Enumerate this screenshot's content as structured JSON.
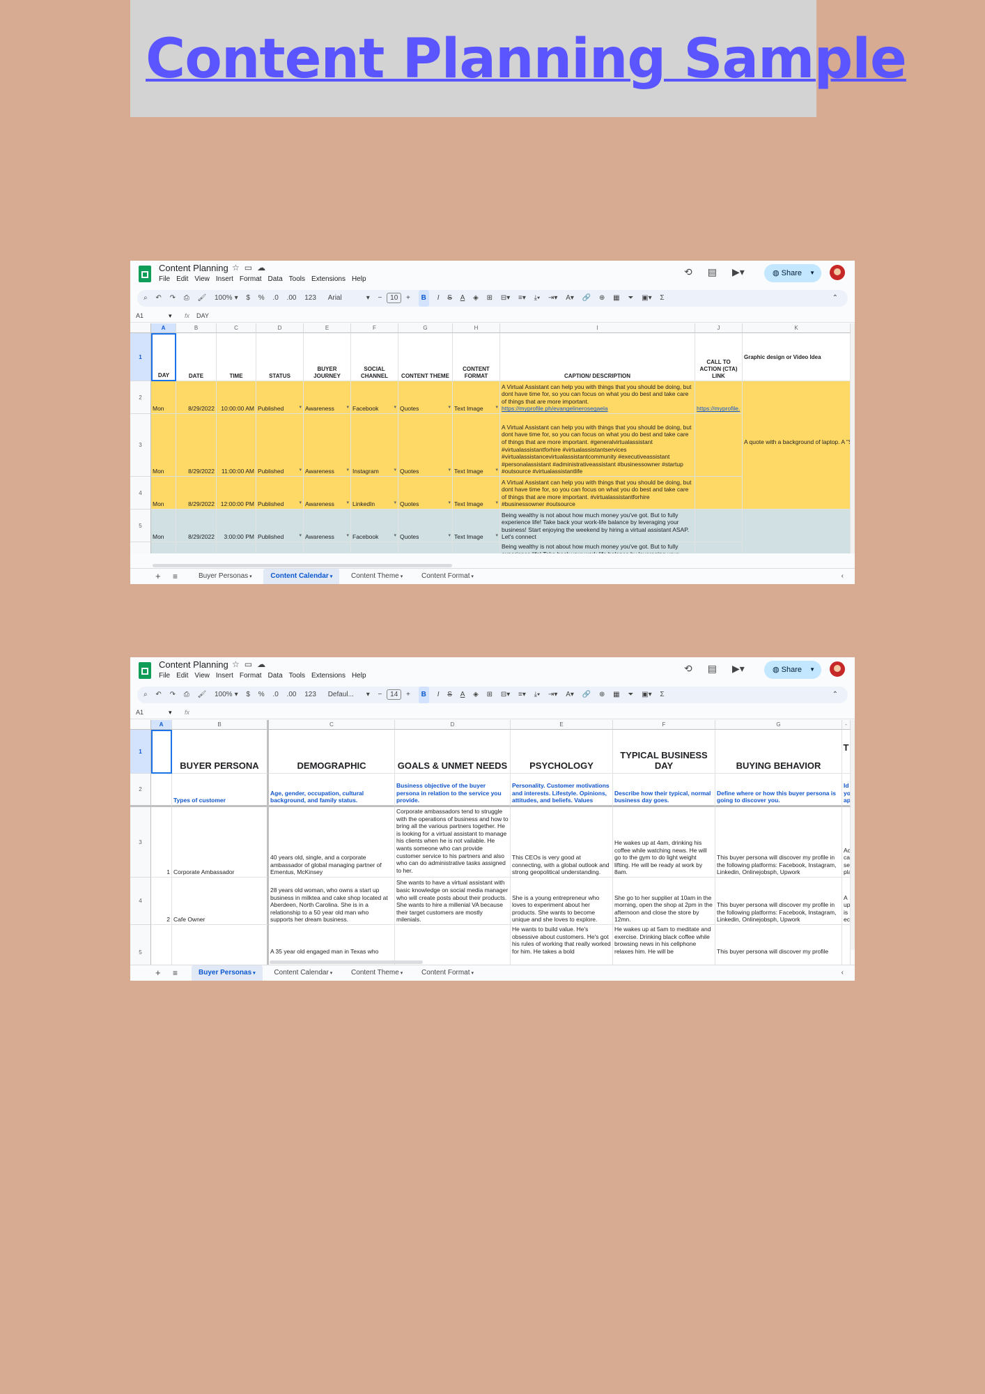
{
  "banner": {
    "title": "Content Planning Sample"
  },
  "menu": [
    "File",
    "Edit",
    "View",
    "Insert",
    "Format",
    "Data",
    "Tools",
    "Extensions",
    "Help"
  ],
  "toolbar": {
    "zoom": "100%",
    "currency": "$",
    "percent": "%",
    "dec_dec": ".0",
    "dec_inc": ".00",
    "format123": "123"
  },
  "share_label": "Share",
  "win1": {
    "doc_title": "Content Planning",
    "font": "Arial",
    "font_size": "10",
    "name_box": "A1",
    "fx": "fx",
    "formula": "DAY",
    "cols": [
      "A",
      "B",
      "C",
      "D",
      "E",
      "F",
      "G",
      "H",
      "I",
      "J",
      "K"
    ],
    "rows": [
      "1",
      "2",
      "3",
      "4",
      "5"
    ],
    "headers": {
      "A": "DAY",
      "B": "DATE",
      "C": "TIME",
      "D": "STATUS",
      "E": "BUYER JOURNEY",
      "F": "SOCIAL CHANNEL",
      "G": "CONTENT THEME",
      "H": "CONTENT FORMAT",
      "I": "CAPTION/ DESCRIPTION",
      "J": "CALL TO ACTION (CTA) LINK",
      "K": "Graphic design or Video Idea"
    },
    "data_rows": [
      {
        "day": "Mon",
        "date": "8/29/2022",
        "time": "10:00:00 AM",
        "status": "Published",
        "journey": "Awareness",
        "channel": "Facebook",
        "theme": "Quotes",
        "format": "Text Image",
        "caption": "A Virtual Assistant  can help you with things that you should be doing, but dont have time for, so you can focus on what you do best and take care of things that are more important.",
        "caption_link": "https://myprofile.ph/evangelinerosegaela",
        "cta": "https://myprofile.",
        "idea": ""
      },
      {
        "day": "Mon",
        "date": "8/29/2022",
        "time": "11:00:00 AM",
        "status": "Published",
        "journey": "Awareness",
        "channel": "Instagram",
        "theme": "Quotes",
        "format": "Text Image",
        "caption": "A Virtual Assistant  can help you with things that you should be doing, but dont have time for, so you can focus on what you do best and take care of things that are more important. #generalvirtualassistant #virtualassistantforhire #virtualassistantservices #virtualassistancevirtualassistantcommunity  #executiveassistant #personalassistant #administrativeassistant #businessowner #startup #outsource #virtualassistantlife",
        "caption_link": "",
        "cta": "",
        "idea": "A quote with a background of laptop. A \"Some things have to end for better th"
      },
      {
        "day": "Mon",
        "date": "8/29/2022",
        "time": "12:00:00 PM",
        "status": "Published",
        "journey": "Awareness",
        "channel": "LinkedIn",
        "theme": "Quotes",
        "format": "Text Image",
        "caption": "A Virtual Assistant can help you with things that you should be doing, but dont have time for, so you can focus on what you do best and take care of things that are more important. #virtualassistantforhire #businessowner #outsource",
        "caption_link": "",
        "cta": "",
        "idea": ""
      },
      {
        "day": "Mon",
        "date": "8/29/2022",
        "time": "3:00:00 PM",
        "status": "Published",
        "journey": "Awareness",
        "channel": "Facebook",
        "theme": "Quotes",
        "format": "Text Image",
        "caption": "Being wealthy is not about how much money you've got. But to fully experience life! Take back your work-life balance by leveraging your business! Start enjoying the weekend by hiring a virtual assistant ASAP. Let's connect",
        "caption_link": "",
        "cta": "",
        "idea": ""
      },
      {
        "caption": "Being wealthy is not about how much money you've got. But to fully experience life! Take back your work-life balance by leveraging your"
      }
    ],
    "tabs": [
      "Buyer Personas",
      "Content Calendar",
      "Content Theme",
      "Content Format"
    ],
    "active_tab": 1
  },
  "win2": {
    "doc_title": "Content Planning",
    "font": "Defaul...",
    "font_size": "14",
    "name_box": "A1",
    "fx": "fx",
    "formula": "",
    "cols": [
      "A",
      "B",
      "C",
      "D",
      "E",
      "F",
      "G",
      "-"
    ],
    "rows": [
      "1",
      "2",
      "3",
      "4",
      "5"
    ],
    "headers": {
      "B": "BUYER PERSONA",
      "C": "DEMOGRAPHIC",
      "D": "GOALS & UNMET NEEDS",
      "E": "PSYCHOLOGY",
      "F": "TYPICAL BUSINESS DAY",
      "G": "BUYING BEHAVIOR",
      "H": "T"
    },
    "subheaders": {
      "B": "Types of customer",
      "C": "Age, gender, occupation, cultural background, and family status.",
      "D": "Business objective of the buyer persona in relation to the service you provide.",
      "E": "Personality. Customer motivations and interests. Lifestyle. Opinions, attitudes, and beliefs. Values",
      "F": "Describe how their typical, normal business day goes.",
      "G": "Define where or how this buyer persona is going to discover you.",
      "H": "Id yo ap"
    },
    "personas": [
      {
        "num": "1",
        "name": "Corporate Ambassador",
        "demo": "40 years old, single, and a corporate ambassador of global managing partner of Ementus, McKinsey",
        "goals": "Corporate ambassadors tend to struggle with the operations of business and how to bring all the various partners together. He is looking for a virtual assistant to manage his clients when he is not vailable. He wants someone who can provide customer service to his partners and also who can do administrative tasks assigned to her.",
        "psych": "This CEOs is very good at connecting, with a global outlook and strong geopolitical understanding.",
        "day": "He wakes up at 4am, drinking his coffee while watching news. He will go to the gym to do light weight lifting. He will be ready at work by 8am.",
        "buying": "This buyer persona will discover my profile in the following platforms: Facebook, Instagram, Linkedin, Onlinejobsph, Upwork",
        "extra": "Ac ca se pla"
      },
      {
        "num": "2",
        "name": "Cafe Owner",
        "demo": "28 years old woman, who owns a start up business in milktea and cake shop located at Aberdeen, North Carolina. She is in a relationship to a 50 year old man who supports her dream business.",
        "goals": "She wants to have a virtual assistant with basic knowledge on social media manager who will create posts about their products. She wants to hire a millenial VA because their target customers are mostly milenials.",
        "psych": "She is a young entrepreneur who loves to experiment about her products.  She wants to become unique and she loves to explore.",
        "day": "She go to her supplier at 10am in the morning, open the shop at 2pm in the afternoon and close the store by 12mn.",
        "buying": "This buyer persona will discover my profile in the following platforms: Facebook, Instagram, Linkedin, Onlinejobsph, Upwork",
        "extra": "A up is ec"
      },
      {
        "num": "",
        "name": "",
        "demo": "A  35 year old engaged man in Texas who",
        "goals": "",
        "psych": "He wants to build value. He's obsessive about customers. He's got his rules of working that really worked for him. He takes a bold",
        "day": "He wakes up at 5am to meditate and exercise. Drinking black coffee while browsing news in his cellphone relaxes him. He will be",
        "buying": "This buyer persona will discover my profile",
        "extra": ""
      }
    ],
    "tabs": [
      "Buyer Personas",
      "Content Calendar",
      "Content Theme",
      "Content Format"
    ],
    "active_tab": 0
  }
}
